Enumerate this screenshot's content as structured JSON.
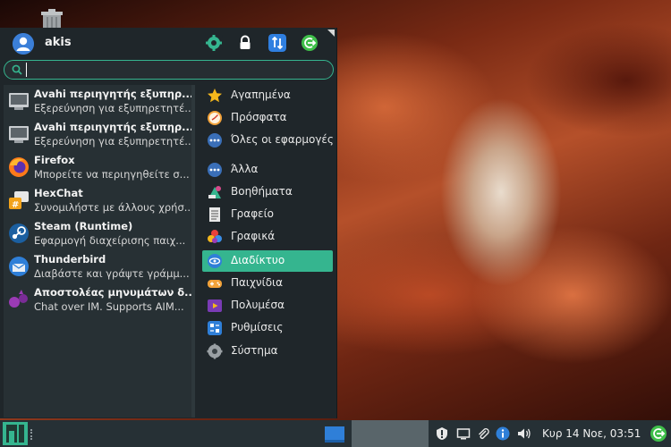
{
  "desktop": {
    "trash_icon": "trash-icon"
  },
  "menu": {
    "username": "akis",
    "header_icons": [
      "settings-icon",
      "lock-icon",
      "switch-user-icon",
      "logout-icon"
    ],
    "search": {
      "value": "",
      "placeholder": ""
    },
    "favorites": [
      {
        "name": "Avahi περιηγητής εξυπηρ...",
        "desc": "Εξερεύνηση για εξυπηρετητέ...",
        "icon": "network-computer-icon"
      },
      {
        "name": "Avahi περιηγητής εξυπηρ...",
        "desc": "Εξερεύνηση για εξυπηρετητέ...",
        "icon": "network-computer-icon"
      },
      {
        "name": "Firefox",
        "desc": "Μπορείτε να περιηγηθείτε σ...",
        "icon": "firefox-icon"
      },
      {
        "name": "HexChat",
        "desc": "Συνομιλήστε με άλλους χρήσ...",
        "icon": "hexchat-icon"
      },
      {
        "name": "Steam (Runtime)",
        "desc": "Εφαρμογή διαχείρισης παιχ...",
        "icon": "steam-icon"
      },
      {
        "name": "Thunderbird",
        "desc": "Διαβάστε και γράψτε γράμμ...",
        "icon": "thunderbird-icon"
      },
      {
        "name": "Αποστολέας μηνυμάτων δ...",
        "desc": "Chat over IM.  Supports AIM...",
        "icon": "pidgin-icon"
      }
    ],
    "categories": [
      {
        "label": "Αγαπημένα",
        "icon": "star-icon",
        "active": false
      },
      {
        "label": "Πρόσφατα",
        "icon": "clock-icon",
        "active": false
      },
      {
        "label": "Όλες οι εφαρμογές",
        "icon": "all-apps-icon",
        "active": false
      },
      {
        "label": "Άλλα",
        "icon": "other-icon",
        "active": false
      },
      {
        "label": "Βοηθήματα",
        "icon": "accessories-icon",
        "active": false
      },
      {
        "label": "Γραφείο",
        "icon": "office-icon",
        "active": false
      },
      {
        "label": "Γραφικά",
        "icon": "graphics-icon",
        "active": false
      },
      {
        "label": "Διαδίκτυο",
        "icon": "internet-icon",
        "active": true
      },
      {
        "label": "Παιχνίδια",
        "icon": "games-icon",
        "active": false
      },
      {
        "label": "Πολυμέσα",
        "icon": "multimedia-icon",
        "active": false
      },
      {
        "label": "Ρυθμίσεις",
        "icon": "settings-icon",
        "active": false
      },
      {
        "label": "Σύστημα",
        "icon": "system-icon",
        "active": false
      }
    ]
  },
  "panel": {
    "clock": "Κυρ 14 Νοε, 03:51",
    "tray_icons": [
      "update-icon",
      "display-icon",
      "clip-icon",
      "info-icon",
      "volume-icon"
    ]
  },
  "colors": {
    "accent": "#35b58f",
    "menu_bg": "#1f262a",
    "panel_bg": "#263035"
  }
}
